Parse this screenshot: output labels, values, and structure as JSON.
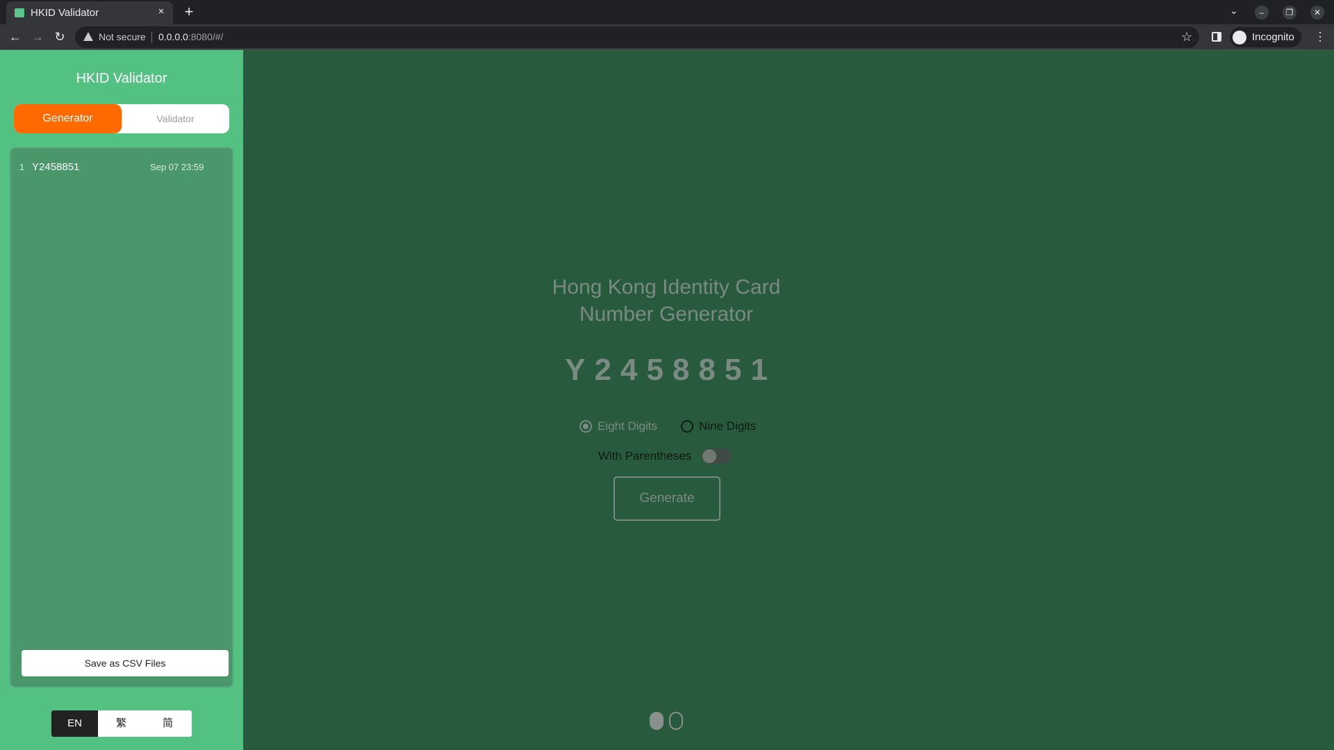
{
  "browser": {
    "tab_title": "HKID Validator",
    "tab_close": "×",
    "new_tab": "+",
    "security_label": "Not secure",
    "url_host": "0.0.0.0",
    "url_rest": ":8080/#/",
    "profile_label": "Incognito",
    "icons": [
      "favicon-icon",
      "close-icon",
      "plus-icon",
      "chevron-down-icon",
      "back-icon",
      "forward-icon",
      "reload-icon",
      "warning-icon",
      "star-icon",
      "side-panel-icon",
      "incognito-icon",
      "menu-icon",
      "minimize-icon",
      "restore-icon",
      "close-window-icon"
    ]
  },
  "sidebar": {
    "title": "HKID Validator",
    "modes": {
      "generator": "Generator",
      "validator": "Validator",
      "active": "Generator"
    },
    "history": [
      {
        "index": "1",
        "id": "Y2458851",
        "time": "Sep 07 23:59"
      }
    ],
    "save_csv": "Save as CSV Files",
    "languages": {
      "en": "EN",
      "traditional": "繁",
      "simplified": "简",
      "active": "EN"
    }
  },
  "main": {
    "heading_line1": "Hong Kong Identity Card",
    "heading_line2": "Number Generator",
    "generated_id": "Y2458851",
    "digits_options": {
      "eight": "Eight Digits",
      "nine": "Nine Digits",
      "selected": "Eight Digits"
    },
    "parentheses_label": "With Parentheses",
    "parentheses_enabled": false,
    "generate_label": "Generate",
    "pager": {
      "pages": 2,
      "current": 1
    }
  },
  "colors": {
    "sidebar_bg": "#53c182",
    "main_bg": "#285a3e",
    "accent": "#ff6a00",
    "muted_text": "#7b8a82"
  }
}
